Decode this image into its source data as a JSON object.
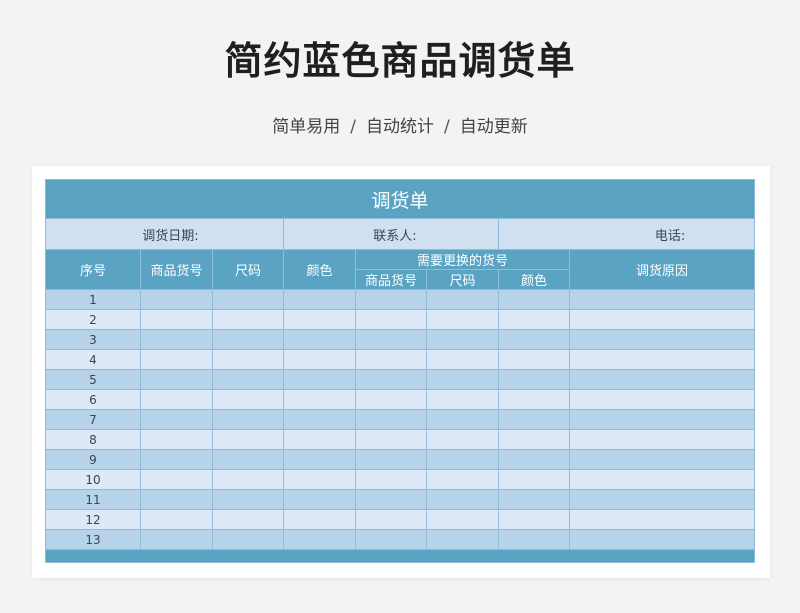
{
  "page": {
    "title": "简约蓝色商品调货单",
    "subtitle_parts": [
      "简单易用",
      "自动统计",
      "自动更新"
    ],
    "separator": "/"
  },
  "sheet": {
    "title": "调货单",
    "info": {
      "date_label": "调货日期:",
      "contact_label": "联系人:",
      "phone_label": "电话:"
    },
    "headers": {
      "seq": "序号",
      "item_no": "商品货号",
      "size": "尺码",
      "color": "颜色",
      "replace_group": "需要更换的货号",
      "replace_item_no": "商品货号",
      "replace_size": "尺码",
      "replace_color": "颜色",
      "reason": "调货原因"
    },
    "rows": [
      "1",
      "2",
      "3",
      "4",
      "5",
      "6",
      "7",
      "8",
      "9",
      "10",
      "11",
      "12",
      "13"
    ]
  },
  "colors": {
    "header_blue": "#5aa3c3",
    "info_bg": "#cfe1f1",
    "row_dark": "#b7d3ea",
    "row_light": "#dde9f6"
  }
}
